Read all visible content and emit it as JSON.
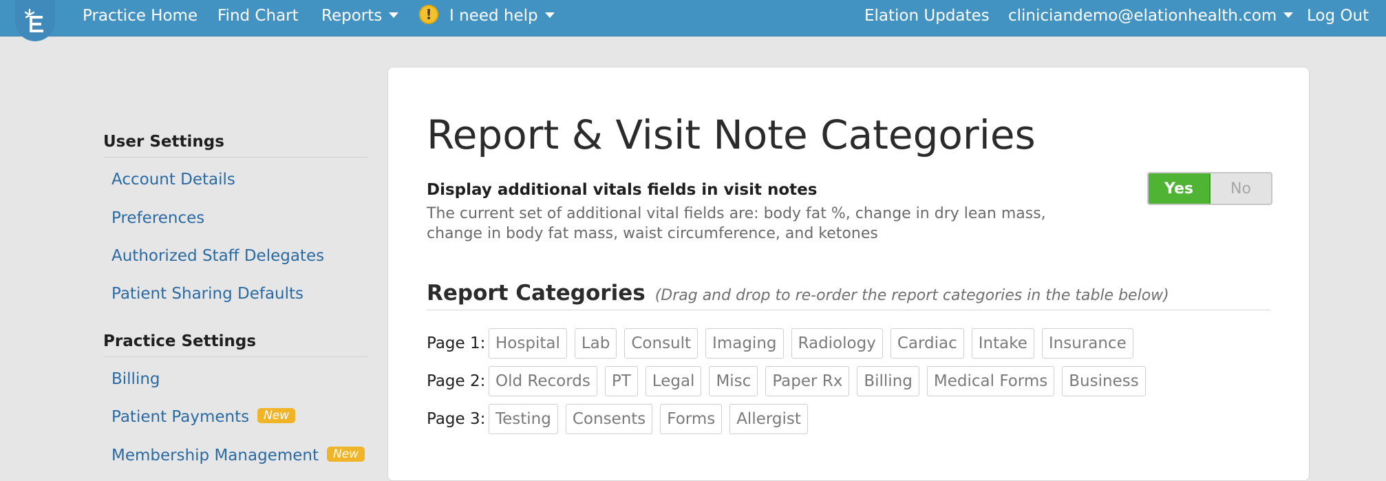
{
  "nav": {
    "home": "Practice Home",
    "find_chart": "Find Chart",
    "reports": "Reports",
    "help": "I need help",
    "updates": "Elation Updates",
    "user_email": "cliniciandemo@elationhealth.com",
    "logout": "Log Out"
  },
  "sidebar": {
    "user_settings_heading": "User Settings",
    "user_items": [
      "Account Details",
      "Preferences",
      "Authorized Staff Delegates",
      "Patient Sharing Defaults"
    ],
    "practice_settings_heading": "Practice Settings",
    "practice_items": [
      {
        "label": "Billing",
        "badge": ""
      },
      {
        "label": "Patient Payments",
        "badge": "New"
      },
      {
        "label": "Membership Management",
        "badge": "New"
      }
    ]
  },
  "main": {
    "title": "Report & Visit Note Categories",
    "vitals": {
      "label": "Display additional vitals fields in visit notes",
      "description": "The current set of additional vital fields are: body fat %, change in dry lean mass, change in body fat mass, waist circumference, and ketones",
      "toggle_yes": "Yes",
      "toggle_no": "No",
      "selected": "Yes"
    },
    "report_categories": {
      "title": "Report Categories",
      "hint": "(Drag and drop to re-order the report categories in the table below)",
      "pages": [
        {
          "label": "Page 1:",
          "tags": [
            "Hospital",
            "Lab",
            "Consult",
            "Imaging",
            "Radiology",
            "Cardiac",
            "Intake",
            "Insurance"
          ]
        },
        {
          "label": "Page 2:",
          "tags": [
            "Old Records",
            "PT",
            "Legal",
            "Misc",
            "Paper Rx",
            "Billing",
            "Medical Forms",
            "Business"
          ]
        },
        {
          "label": "Page 3:",
          "tags": [
            "Testing",
            "Consents",
            "Forms",
            "Allergist"
          ]
        }
      ]
    }
  },
  "colors": {
    "navbar": "#4393c2",
    "link": "#2a6aa3",
    "toggle_on": "#4fb434",
    "badge": "#f0b429"
  }
}
